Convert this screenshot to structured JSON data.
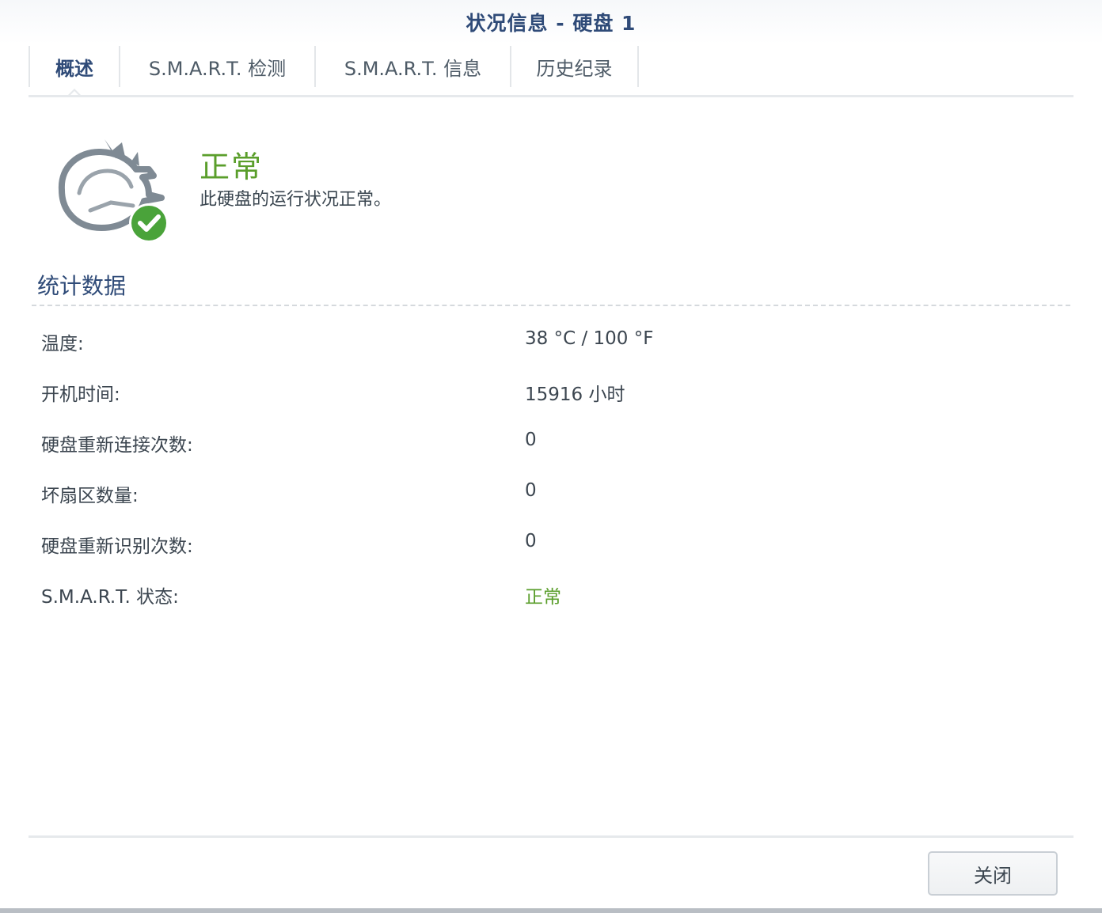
{
  "window": {
    "title": "状况信息 - 硬盘 1"
  },
  "tabs": [
    {
      "label": "概述",
      "active": true
    },
    {
      "label": "S.M.A.R.T. 检测",
      "active": false
    },
    {
      "label": "S.M.A.R.T. 信息",
      "active": false
    },
    {
      "label": "历史纪录",
      "active": false
    }
  ],
  "status": {
    "title": "正常",
    "description": "此硬盘的运行状况正常。",
    "icon": "disk-healthy-icon",
    "color": "#5a9e2b"
  },
  "stats": {
    "section_title": "统计数据",
    "rows": [
      {
        "label": "温度:",
        "value": "38 °C / 100 °F"
      },
      {
        "label": "开机时间:",
        "value": "15916 小时"
      },
      {
        "label": "硬盘重新连接次数:",
        "value": "0"
      },
      {
        "label": "坏扇区数量:",
        "value": "0"
      },
      {
        "label": "硬盘重新识别次数:",
        "value": "0"
      },
      {
        "label": "S.M.A.R.T. 状态:",
        "value": "正常"
      }
    ]
  },
  "footer": {
    "close_label": "关闭"
  },
  "colors": {
    "accent": "#2f4b78",
    "healthy": "#5a9e2b"
  }
}
